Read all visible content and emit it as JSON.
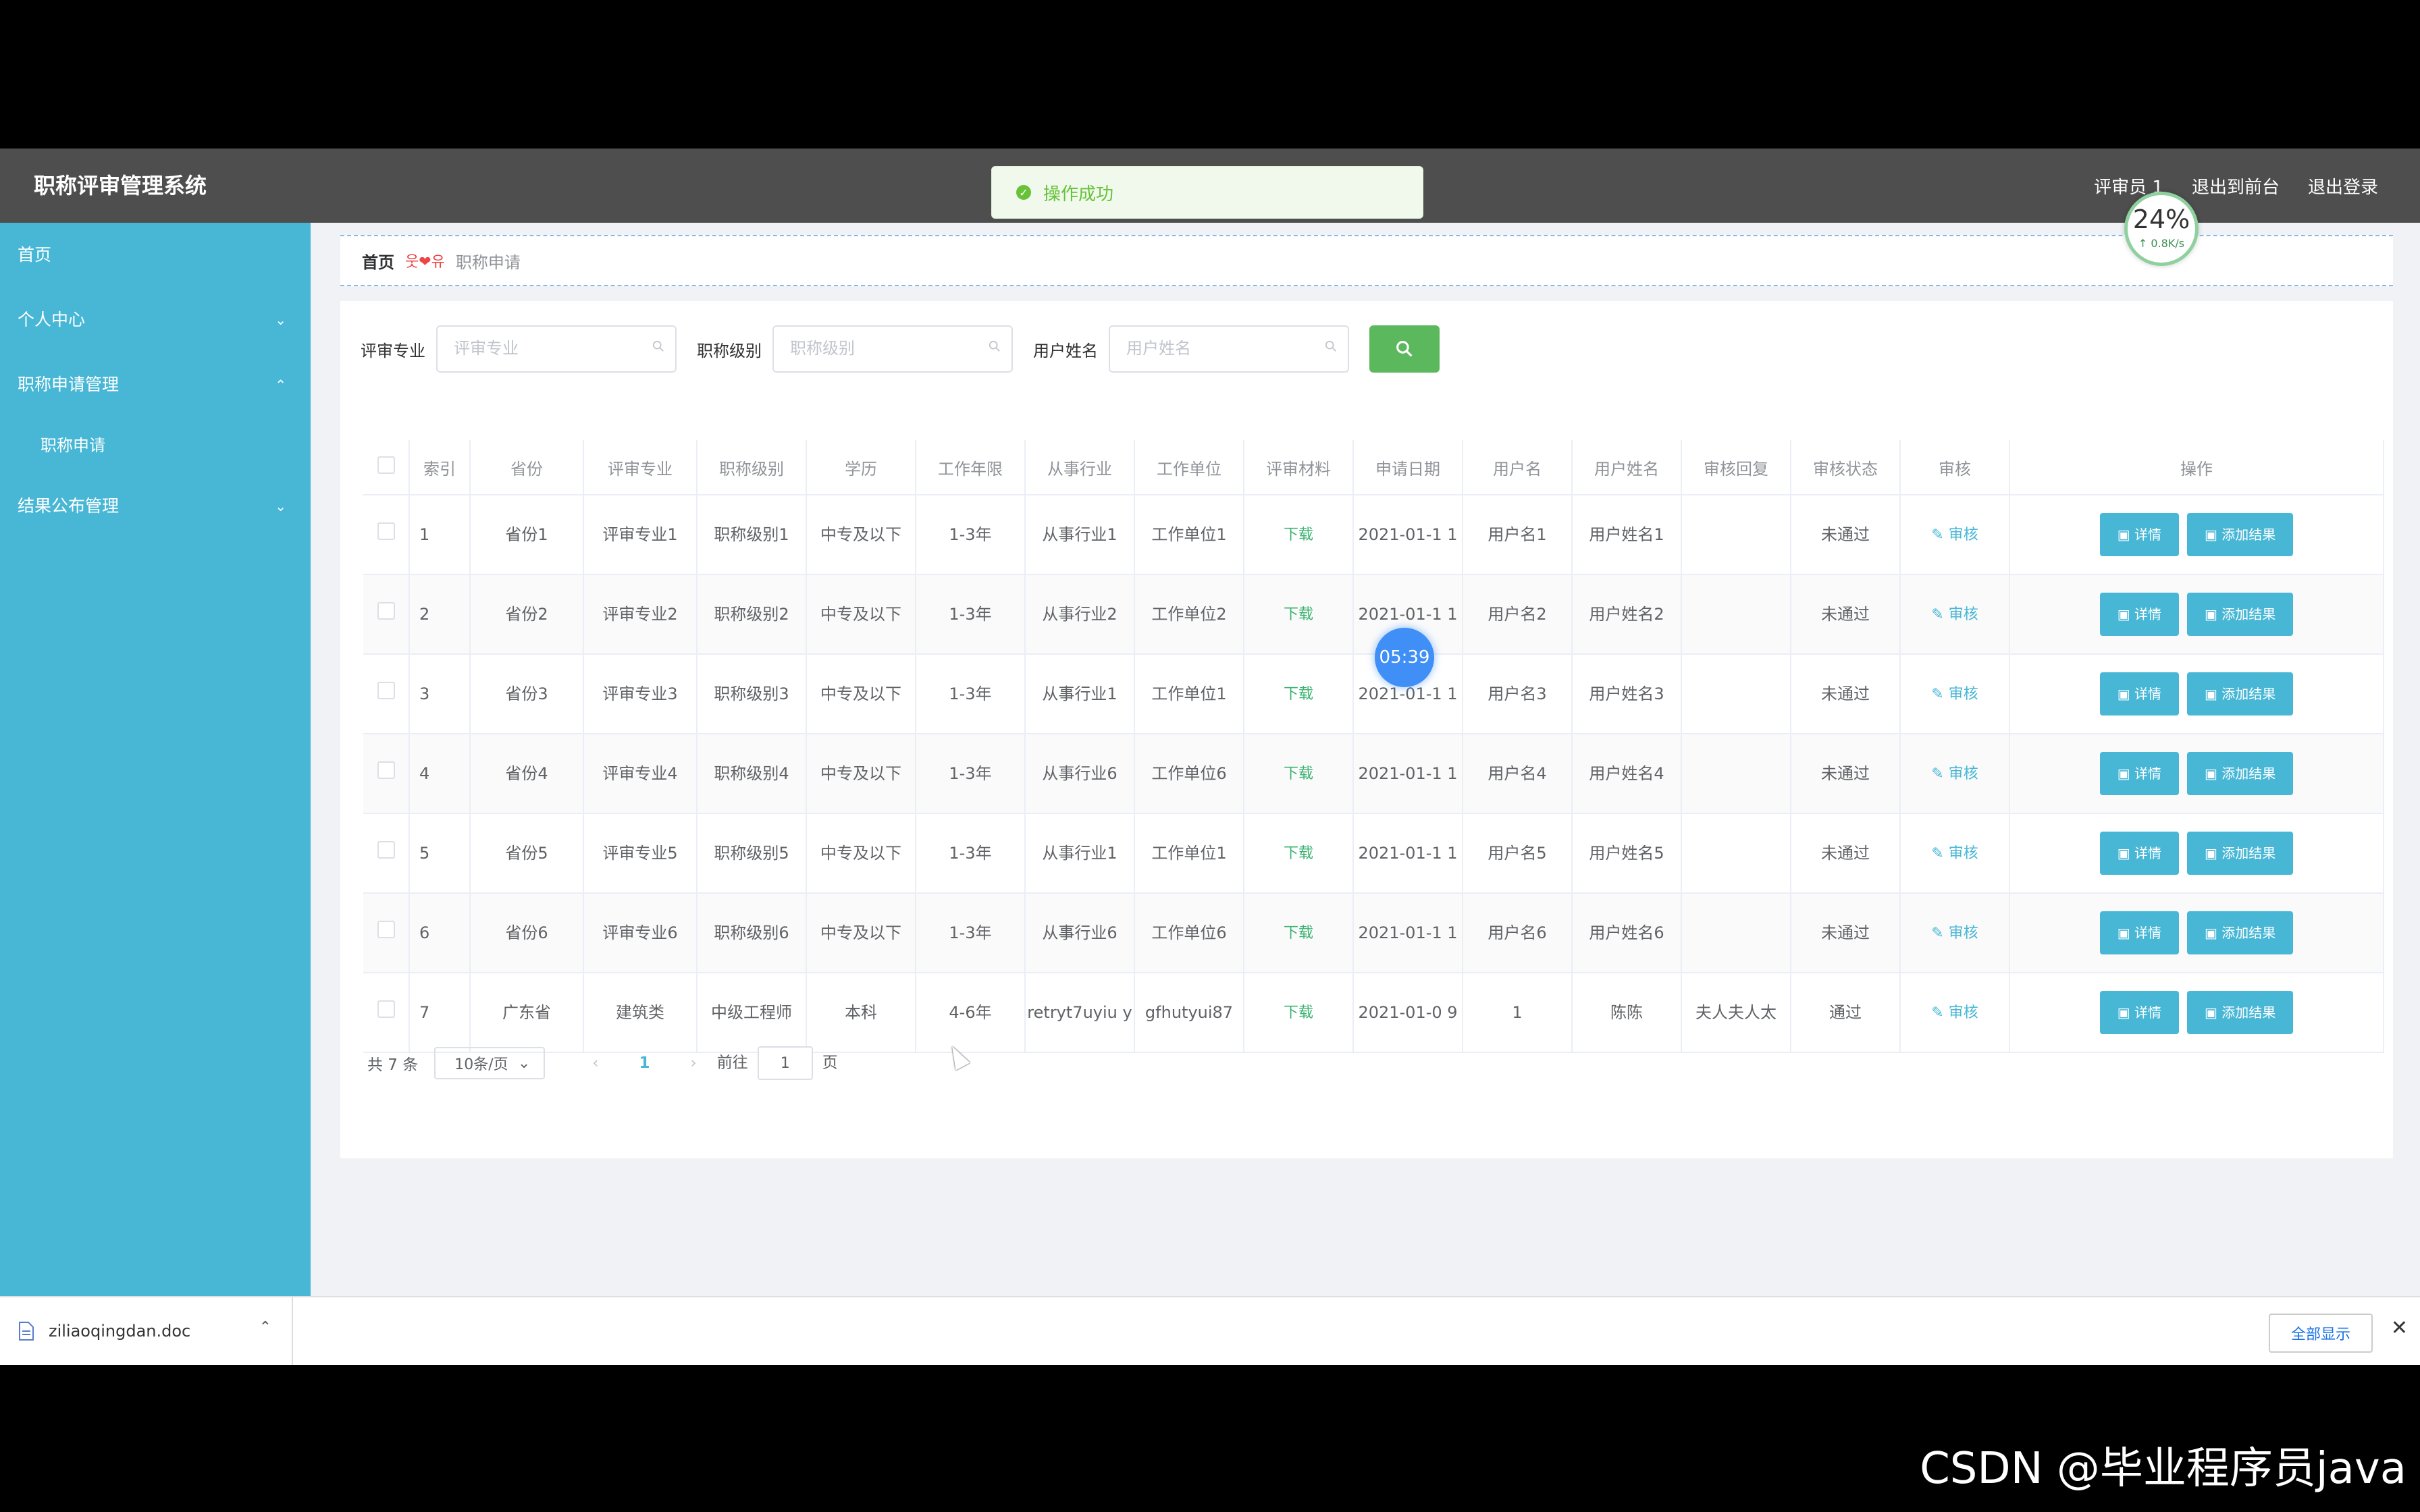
{
  "app": {
    "title": "职称评审管理系统",
    "user": "评审员 1",
    "to_frontend": "退出到前台",
    "logout": "退出登录"
  },
  "toast": {
    "message": "操作成功"
  },
  "sidebar": {
    "items": [
      {
        "label": "首页",
        "chevron": ""
      },
      {
        "label": "个人中心",
        "chevron": "⌄"
      },
      {
        "label": "职称申请管理",
        "chevron": "⌃"
      },
      {
        "label": "职称申请",
        "chevron": ""
      },
      {
        "label": "结果公布管理",
        "chevron": "⌄"
      }
    ]
  },
  "breadcrumb": {
    "home": "首页",
    "separator": "웃❤유",
    "current": "职称申请"
  },
  "search": {
    "major_label": "评审专业",
    "major_placeholder": "评审专业",
    "level_label": "职称级别",
    "level_placeholder": "职称级别",
    "name_label": "用户姓名",
    "name_placeholder": "用户姓名",
    "button_icon": "search-icon"
  },
  "table": {
    "columns": [
      "",
      "索引",
      "省份",
      "评审专业",
      "职称级别",
      "学历",
      "工作年限",
      "从事行业",
      "工作单位",
      "评审材料",
      "申请日期",
      "用户名",
      "用户姓名",
      "审核回复",
      "审核状态",
      "审核",
      "操作"
    ],
    "rows": [
      {
        "idx": "1",
        "province": "省份1",
        "major": "评审专业1",
        "level": "职称级别1",
        "edu": "中专及以下",
        "years": "1-3年",
        "industry": "从事行业1",
        "unit": "工作单位1",
        "material": "下载",
        "date": "2021-01-1 1",
        "username": "用户名1",
        "realname": "用户姓名1",
        "reply": "",
        "status": "未通过",
        "audit": "审核",
        "detail": "详情",
        "add_result": "添加结果"
      },
      {
        "idx": "2",
        "province": "省份2",
        "major": "评审专业2",
        "level": "职称级别2",
        "edu": "中专及以下",
        "years": "1-3年",
        "industry": "从事行业2",
        "unit": "工作单位2",
        "material": "下载",
        "date": "2021-01-1 1",
        "username": "用户名2",
        "realname": "用户姓名2",
        "reply": "",
        "status": "未通过",
        "audit": "审核",
        "detail": "详情",
        "add_result": "添加结果"
      },
      {
        "idx": "3",
        "province": "省份3",
        "major": "评审专业3",
        "level": "职称级别3",
        "edu": "中专及以下",
        "years": "1-3年",
        "industry": "从事行业1",
        "unit": "工作单位1",
        "material": "下载",
        "date": "2021-01-1 1",
        "username": "用户名3",
        "realname": "用户姓名3",
        "reply": "",
        "status": "未通过",
        "audit": "审核",
        "detail": "详情",
        "add_result": "添加结果"
      },
      {
        "idx": "4",
        "province": "省份4",
        "major": "评审专业4",
        "level": "职称级别4",
        "edu": "中专及以下",
        "years": "1-3年",
        "industry": "从事行业6",
        "unit": "工作单位6",
        "material": "下载",
        "date": "2021-01-1 1",
        "username": "用户名4",
        "realname": "用户姓名4",
        "reply": "",
        "status": "未通过",
        "audit": "审核",
        "detail": "详情",
        "add_result": "添加结果"
      },
      {
        "idx": "5",
        "province": "省份5",
        "major": "评审专业5",
        "level": "职称级别5",
        "edu": "中专及以下",
        "years": "1-3年",
        "industry": "从事行业1",
        "unit": "工作单位1",
        "material": "下载",
        "date": "2021-01-1 1",
        "username": "用户名5",
        "realname": "用户姓名5",
        "reply": "",
        "status": "未通过",
        "audit": "审核",
        "detail": "详情",
        "add_result": "添加结果"
      },
      {
        "idx": "6",
        "province": "省份6",
        "major": "评审专业6",
        "level": "职称级别6",
        "edu": "中专及以下",
        "years": "1-3年",
        "industry": "从事行业6",
        "unit": "工作单位6",
        "material": "下载",
        "date": "2021-01-1 1",
        "username": "用户名6",
        "realname": "用户姓名6",
        "reply": "",
        "status": "未通过",
        "audit": "审核",
        "detail": "详情",
        "add_result": "添加结果"
      },
      {
        "idx": "7",
        "province": "广东省",
        "major": "建筑类",
        "level": "中级工程师",
        "edu": "本科",
        "years": "4-6年",
        "industry": "retryt7uyiu y",
        "unit": "gfhutyui87",
        "material": "下载",
        "date": "2021-01-0 9",
        "username": "1",
        "realname": "陈陈",
        "reply": "夫人夫人太",
        "status": "通过",
        "audit": "审核",
        "detail": "详情",
        "add_result": "添加结果"
      }
    ]
  },
  "pager": {
    "total": "共 7 条",
    "page_size": "10条/页",
    "current": "1",
    "goto_label": "前往",
    "goto_value": "1",
    "page_unit": "页"
  },
  "overlays": {
    "speed_percent": "24%",
    "speed_rate": "↑ 0.8K/s",
    "timer": "05:39"
  },
  "download_bar": {
    "filename": "ziliaoqingdan.doc",
    "show_all": "全部显示"
  },
  "watermark": "CSDN @毕业程序员java",
  "colors": {
    "sidebar": "#48b7d6",
    "topbar": "#4e4e4e",
    "accent": "#48b7d6",
    "search_button": "#5cb85c",
    "toast_text": "#67c23a"
  }
}
